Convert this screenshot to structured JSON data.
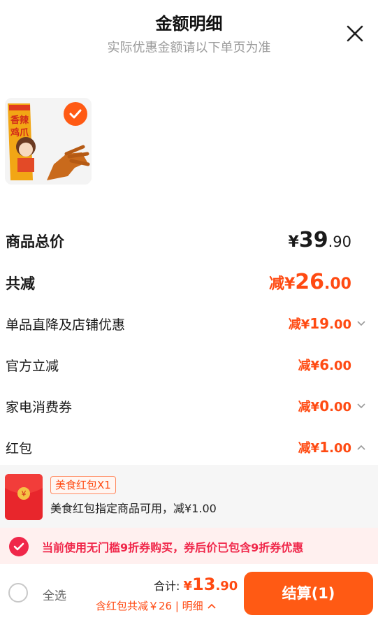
{
  "header": {
    "title": "金额明细",
    "subtitle": "实际优惠金额请以下单页为准",
    "close_icon": "close-icon"
  },
  "product": {
    "package_text_1": "香辣",
    "package_text_2": "鸡爪",
    "selected": true
  },
  "rows": [
    {
      "label": "商品总价",
      "prefix": "",
      "yen": "¥",
      "int": "39",
      "dec": ".90",
      "expandable": false,
      "color": "#1a1a1a"
    },
    {
      "label": "共减",
      "prefix": "减",
      "yen": "¥",
      "int": "26",
      "dec": ".00",
      "expandable": false,
      "color": "#ff4a12"
    },
    {
      "label": "单品直降及店铺优惠",
      "prefix": "减",
      "yen": "¥",
      "int": "19",
      "dec": ".00",
      "expandable": true,
      "expanded": false,
      "color": "#ff4a12"
    },
    {
      "label": "官方立减",
      "prefix": "减",
      "yen": "¥",
      "int": "6",
      "dec": ".00",
      "expandable": false,
      "color": "#ff4a12"
    },
    {
      "label": "家电消费券",
      "prefix": "减",
      "yen": "¥",
      "int": "0",
      "dec": ".00",
      "expandable": true,
      "expanded": false,
      "color": "#ff4a12"
    },
    {
      "label": "红包",
      "prefix": "减",
      "yen": "¥",
      "int": "1",
      "dec": ".00",
      "expandable": true,
      "expanded": true,
      "color": "#ff4a12"
    }
  ],
  "red_packet": {
    "icon_symbol": "¥",
    "tag": "美食红包X1",
    "description": "美食红包指定商品可用，减¥1.00"
  },
  "notice": {
    "text": "当前使用无门槛9折券购买，券后价已包含9折券优惠"
  },
  "footer": {
    "select_all": "全选",
    "total_label": "合计:",
    "total_yen": "¥",
    "total_int": "13",
    "total_dec": ".90",
    "sub_text": "含红包共减￥26 | 明细",
    "checkout_label": "结算(1)"
  },
  "colors": {
    "accent": "#ff5a14",
    "discount": "#ff4a12",
    "notice": "#f0274a"
  }
}
